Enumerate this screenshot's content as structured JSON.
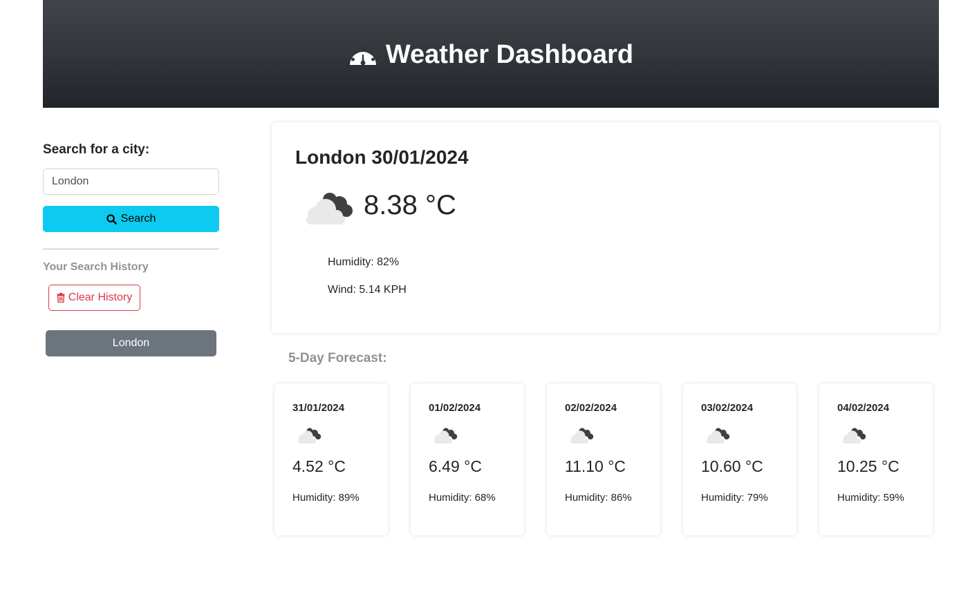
{
  "header": {
    "title": "Weather Dashboard",
    "icon": "gauge-icon"
  },
  "sidebar": {
    "search_label": "Search for a city:",
    "search_input_value": "London",
    "search_button_label": "Search",
    "search_icon": "search-icon",
    "history_label": "Your Search History",
    "clear_button_label": "Clear History",
    "clear_icon": "trash-icon",
    "history_items": [
      "London"
    ]
  },
  "current": {
    "title": "London 30/01/2024",
    "temp": "8.38 °C",
    "humidity": "Humidity: 82%",
    "wind": "Wind: 5.14 KPH",
    "icon": "broken-clouds-icon"
  },
  "forecast": {
    "heading": "5-Day Forecast:",
    "days": [
      {
        "date": "31/01/2024",
        "temp": "4.52 °C",
        "humidity": "Humidity: 89%",
        "icon": "broken-clouds-icon"
      },
      {
        "date": "01/02/2024",
        "temp": "6.49 °C",
        "humidity": "Humidity: 68%",
        "icon": "broken-clouds-icon"
      },
      {
        "date": "02/02/2024",
        "temp": "11.10 °C",
        "humidity": "Humidity: 86%",
        "icon": "broken-clouds-icon"
      },
      {
        "date": "03/02/2024",
        "temp": "10.60 °C",
        "humidity": "Humidity: 79%",
        "icon": "broken-clouds-icon"
      },
      {
        "date": "04/02/2024",
        "temp": "10.25 °C",
        "humidity": "Humidity: 59%",
        "icon": "broken-clouds-icon"
      }
    ]
  },
  "colors": {
    "header_top": "#41454a",
    "header_bottom": "#212529",
    "search_button": "#0dcaf0",
    "clear_button": "#dc3545",
    "history_button": "#6c757d",
    "muted_text": "#8f9396"
  }
}
